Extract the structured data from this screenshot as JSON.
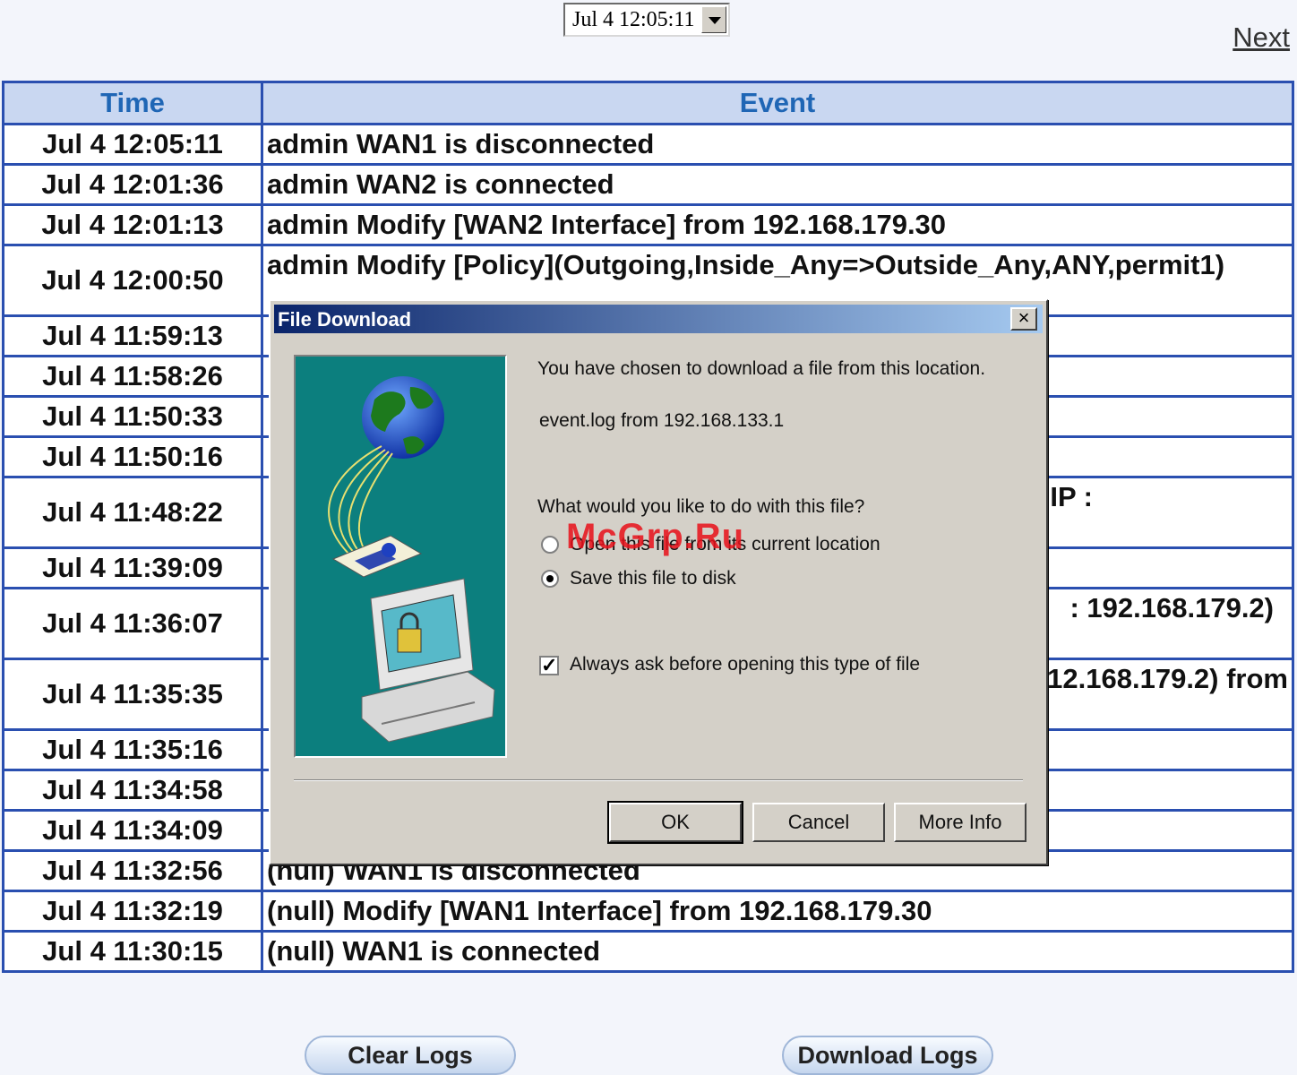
{
  "toolbar": {
    "date_select_value": "Jul 4 12:05:11",
    "next_label": "Next"
  },
  "table": {
    "headers": {
      "time": "Time",
      "event": "Event"
    },
    "rows": [
      {
        "time": "Jul 4 12:05:11",
        "event": "admin WAN1 is disconnected"
      },
      {
        "time": "Jul 4 12:01:36",
        "event": "admin WAN2 is connected"
      },
      {
        "time": "Jul 4 12:01:13",
        "event": "admin Modify [WAN2 Interface] from 192.168.179.30"
      },
      {
        "time": "Jul 4 12:00:50",
        "event": "admin Modify [Policy](Outgoing,Inside_Any=>Outside_Any,ANY,permit1)"
      },
      {
        "time": "Jul 4 11:59:13",
        "event": ""
      },
      {
        "time": "Jul 4 11:58:26",
        "event": ""
      },
      {
        "time": "Jul 4 11:50:33",
        "event": ""
      },
      {
        "time": "Jul 4 11:50:16",
        "event": ""
      },
      {
        "time": "Jul 4 11:48:22",
        "event": "IP :"
      },
      {
        "time": "Jul 4 11:39:09",
        "event": ""
      },
      {
        "time": "Jul 4 11:36:07",
        "event": ": 192.168.179.2)"
      },
      {
        "time": "Jul 4 11:35:35",
        "event": "12.168.179.2) from"
      },
      {
        "time": "Jul 4 11:35:16",
        "event": ""
      },
      {
        "time": "Jul 4 11:34:58",
        "event": ""
      },
      {
        "time": "Jul 4 11:34:09",
        "event": ""
      },
      {
        "time": "Jul 4 11:32:56",
        "event": "(null) WAN1 is disconnected"
      },
      {
        "time": "Jul 4 11:32:19",
        "event": "(null) Modify [WAN1 Interface] from 192.168.179.30"
      },
      {
        "time": "Jul 4 11:30:15",
        "event": "(null) WAN1 is connected"
      }
    ]
  },
  "buttons": {
    "clear_logs": "Clear Logs",
    "download_logs": "Download Logs"
  },
  "dialog": {
    "title": "File Download",
    "close_glyph": "×",
    "intro": "You have chosen to download a file from this location.",
    "file_source": "event.log from 192.168.133.1",
    "question": "What would you like to do with this file?",
    "option_open": "Open this file from its current location",
    "option_save": "Save this file to disk",
    "always_ask": "Always ask before opening this type of file",
    "ok": "OK",
    "cancel": "Cancel",
    "more_info": "More Info"
  },
  "watermark": "McGrp.Ru"
}
